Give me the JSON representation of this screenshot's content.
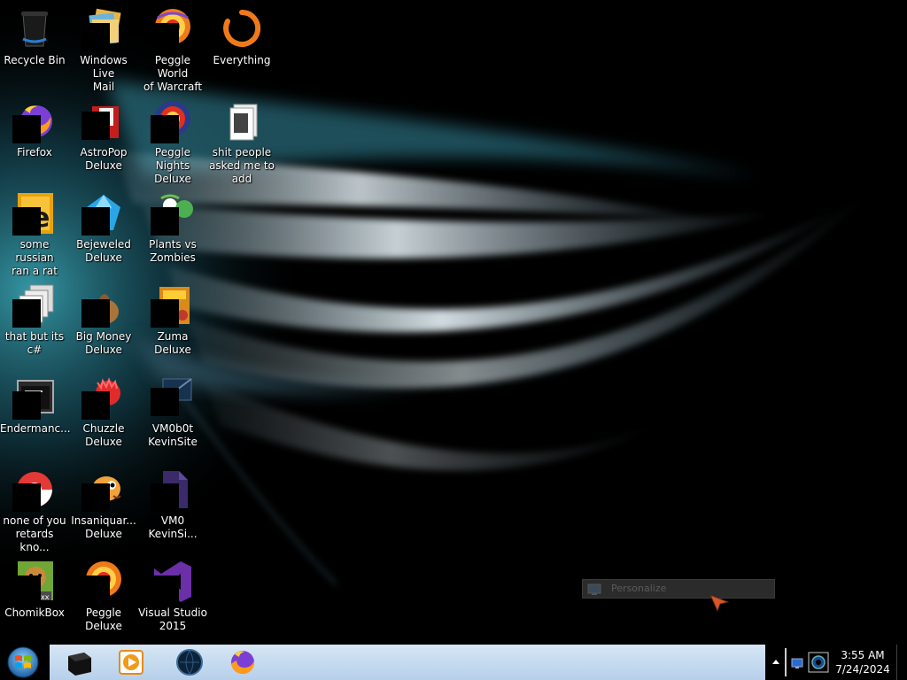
{
  "desktop": {
    "icons": [
      {
        "id": "recycle-bin",
        "label": "Recycle Bin",
        "icon": "recycle-bin-icon"
      },
      {
        "id": "windows-live-mail",
        "label": "Windows Live\nMail",
        "icon": "mail-icon"
      },
      {
        "id": "peggle-world-of-warcraft",
        "label": "Peggle World\nof Warcraft ...",
        "icon": "peggle-icon"
      },
      {
        "id": "everything",
        "label": "Everything",
        "icon": "search-icon"
      },
      {
        "id": "firefox",
        "label": "Firefox",
        "icon": "firefox-icon"
      },
      {
        "id": "astropop-deluxe",
        "label": "AstroPop\nDeluxe",
        "icon": "astropop-icon"
      },
      {
        "id": "peggle-nights-deluxe",
        "label": "Peggle Nights\nDeluxe",
        "icon": "peggle-nights-icon"
      },
      {
        "id": "folder-people-asked",
        "label": "shit people\nasked me to\nadd",
        "icon": "folder-icon"
      },
      {
        "id": "some-russian-ran-a-rat",
        "label": "some russian\nran a rat",
        "icon": "java-icon"
      },
      {
        "id": "bejeweled-deluxe",
        "label": "Bejeweled\nDeluxe",
        "icon": "gem-icon"
      },
      {
        "id": "plants-vs-zombies",
        "label": "Plants vs\nZombies",
        "icon": "plant-icon"
      },
      {
        "id": "that-but-its-csharp",
        "label": "that but its c#",
        "icon": "copy-icon"
      },
      {
        "id": "big-money-deluxe",
        "label": "Big Money\nDeluxe",
        "icon": "money-bag-icon"
      },
      {
        "id": "zuma-deluxe",
        "label": "Zuma Deluxe",
        "icon": "zuma-icon"
      },
      {
        "id": "endermanch",
        "label": "Endermanc...",
        "icon": "terminal-icon"
      },
      {
        "id": "chuzzle-deluxe",
        "label": "Chuzzle\nDeluxe",
        "icon": "chuzzle-icon"
      },
      {
        "id": "vm0b0t-kevinsite",
        "label": "VM0b0t\nKevinSite",
        "icon": "vm-icon"
      },
      {
        "id": "none-of-you-retards",
        "label": "none of you\nretards kno...",
        "icon": "chrome-icon"
      },
      {
        "id": "insaniquarium-deluxe",
        "label": "Insaniquar...\nDeluxe",
        "icon": "fish-icon"
      },
      {
        "id": "vm0-kevinsite",
        "label": "VM0\nKevinSi...",
        "icon": "file-icon"
      },
      {
        "id": "chomikbox",
        "label": "ChomikBox",
        "icon": "hamster-icon"
      },
      {
        "id": "peggle-deluxe",
        "label": "Peggle Deluxe",
        "icon": "peggle-deluxe-icon"
      },
      {
        "id": "visual-studio-2015",
        "label": "Visual Studio\n2015",
        "icon": "visual-studio-icon"
      }
    ]
  },
  "context_menu": {
    "items": [
      {
        "label": "Personalize",
        "icon": "personalize-icon"
      }
    ]
  },
  "taskbar": {
    "start_icon": "windows-logo-icon",
    "pinned": [
      {
        "name": "black-box-app",
        "icon": "cube-icon"
      },
      {
        "name": "windows-media-player",
        "icon": "media-player-icon"
      },
      {
        "name": "dark-globe-app",
        "icon": "globe-icon"
      },
      {
        "name": "firefox",
        "icon": "firefox-icon"
      }
    ],
    "clock": {
      "time": "3:55 AM",
      "date": "7/24/2024"
    }
  },
  "colors": {
    "taskbar_band": "#c6dcf0",
    "icon_label": "#ffffff",
    "wallpaper_streak": "#cfe4f0",
    "wallpaper_teal": "#2a8fa0"
  }
}
